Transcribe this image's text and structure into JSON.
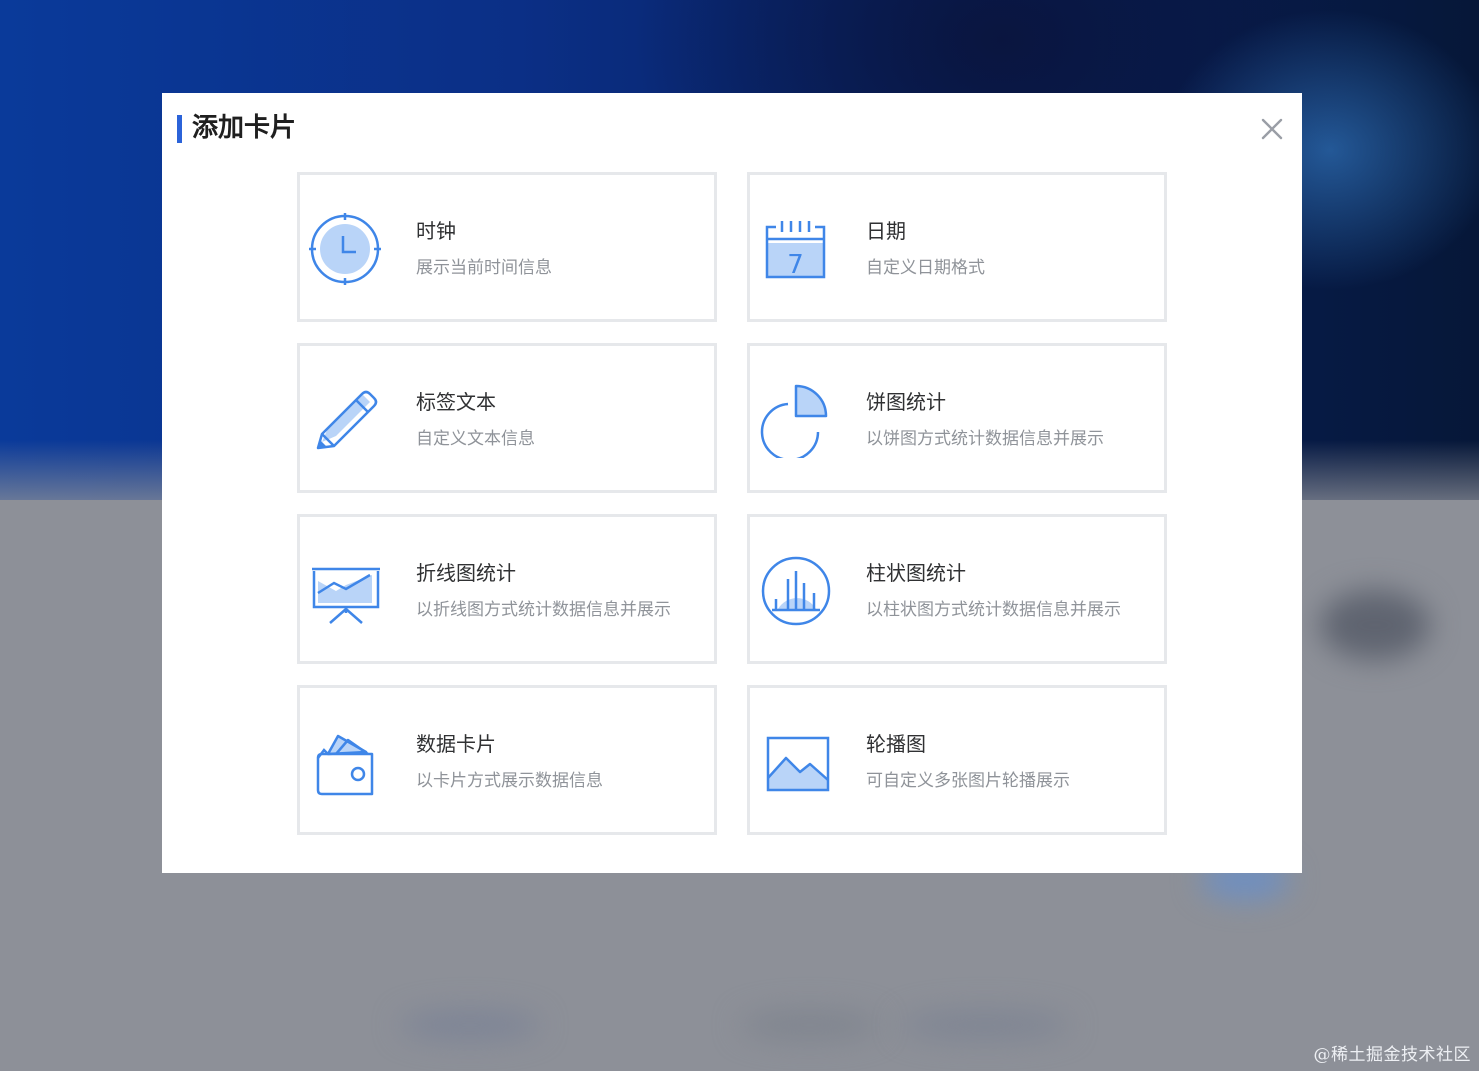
{
  "dialog": {
    "title": "添加卡片",
    "close_icon": "close-icon"
  },
  "cards": [
    {
      "name": "时钟",
      "desc": "展示当前时间信息",
      "icon": "clock-icon"
    },
    {
      "name": "日期",
      "desc": "自定义日期格式",
      "icon": "calendar-icon",
      "icon_text": "7"
    },
    {
      "name": "标签文本",
      "desc": "自定义文本信息",
      "icon": "pencil-icon"
    },
    {
      "name": "饼图统计",
      "desc": "以饼图方式统计数据信息并展示",
      "icon": "pie-chart-icon"
    },
    {
      "name": "折线图统计",
      "desc": "以折线图方式统计数据信息并展示",
      "icon": "line-chart-icon"
    },
    {
      "name": "柱状图统计",
      "desc": "以柱状图方式统计数据信息并展示",
      "icon": "bar-chart-icon"
    },
    {
      "name": "数据卡片",
      "desc": "以卡片方式展示数据信息",
      "icon": "wallet-icon"
    },
    {
      "name": "轮播图",
      "desc": "可自定义多张图片轮播展示",
      "icon": "image-icon"
    }
  ],
  "watermark": "@稀土掘金技术社区",
  "colors": {
    "accent": "#2b63d9",
    "icon_stroke": "#3f86e8",
    "icon_fill": "#b9d4f8",
    "card_border": "#e6e8eb",
    "title_text": "#303133",
    "desc_text": "#8f9399"
  }
}
